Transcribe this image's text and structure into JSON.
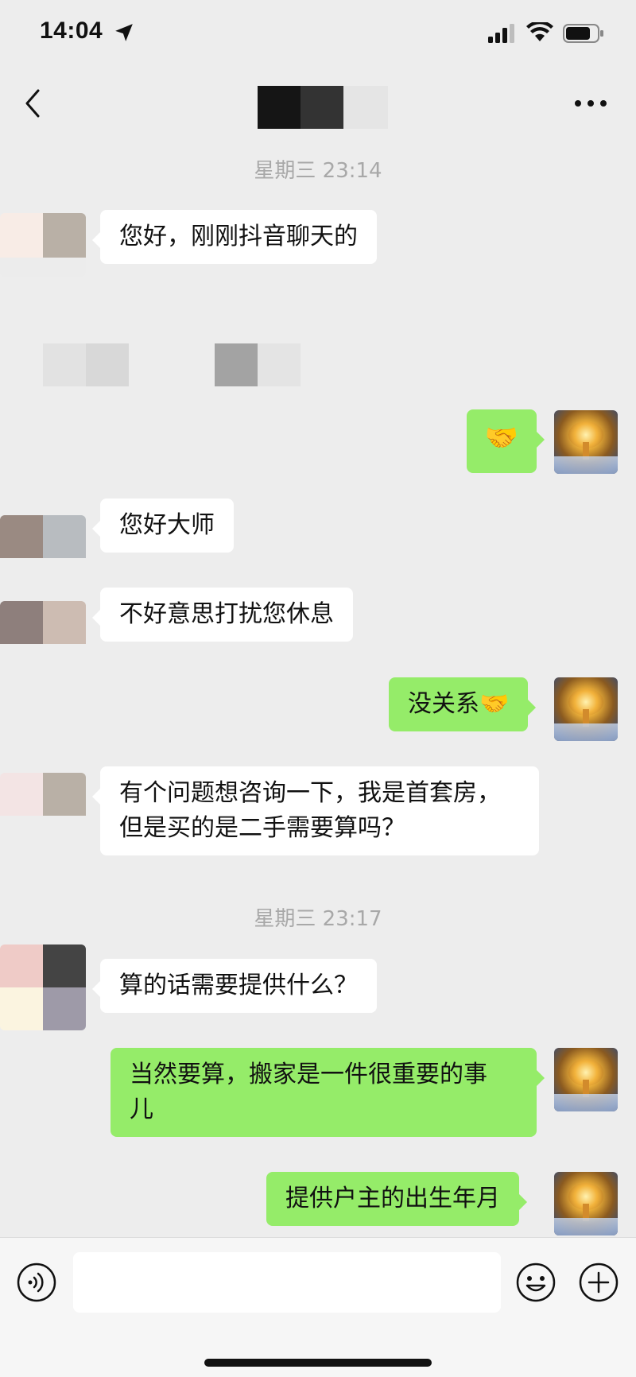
{
  "status_bar": {
    "time": "14:04",
    "icons": [
      "location-arrow-icon",
      "signal-icon",
      "wifi-icon",
      "battery-icon"
    ]
  },
  "nav": {
    "back_icon": "chevron-left-icon",
    "more_icon": "ellipsis-icon"
  },
  "timestamps": [
    "星期三 23:14",
    "星期三 23:17"
  ],
  "messages": [
    {
      "side": "in",
      "text": "您好，刚刚抖音聊天的"
    },
    {
      "side": "out",
      "text": "🤝"
    },
    {
      "side": "in",
      "text": "您好大师"
    },
    {
      "side": "in",
      "text": "不好意思打扰您休息"
    },
    {
      "side": "out",
      "text": "没关系🤝"
    },
    {
      "side": "in",
      "text": "有个问题想咨询一下，我是首套房，"
    },
    {
      "side": "in",
      "text": "但是买的是二手需要算吗？"
    },
    {
      "side": "in",
      "text": "算的话需要提供什么？"
    },
    {
      "side": "out",
      "text": "当然要算，搬家是一件很重要的事"
    },
    {
      "side": "out",
      "text": "儿"
    },
    {
      "side": "out",
      "text": "提供户主的出生年月"
    }
  ],
  "input_bar": {
    "placeholder": "",
    "icons": [
      "voice-icon",
      "emoji-icon",
      "plus-icon"
    ]
  },
  "colors": {
    "background": "#ededed",
    "incoming_bubble": "#ffffff",
    "outgoing_bubble": "#95ec69",
    "timestamp_text": "#a8a8a8"
  }
}
